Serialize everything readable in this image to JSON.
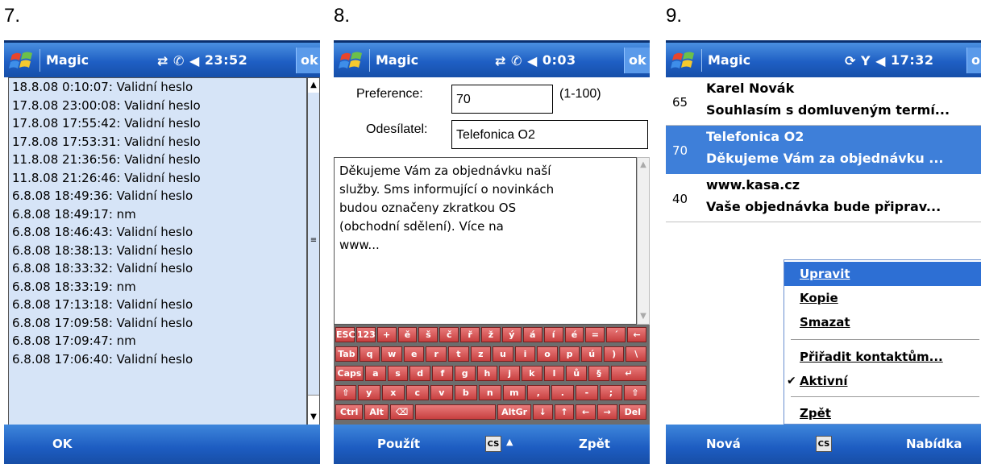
{
  "screens": [
    {
      "number": "7.",
      "title": "Magic",
      "clock": "23:52",
      "ok": "ok"
    },
    {
      "number": "8.",
      "title": "Magic",
      "clock": "0:03",
      "ok": "ok"
    },
    {
      "number": "9.",
      "title": "Magic",
      "clock": "17:32",
      "ok": "ok"
    }
  ],
  "screen7": {
    "log": [
      "18.8.08 0:10:07: Validní heslo",
      "17.8.08 23:00:08: Validní heslo",
      "17.8.08 17:55:42: Validní heslo",
      "17.8.08 17:53:31: Validní heslo",
      "11.8.08 21:36:56: Validní heslo",
      "11.8.08 21:26:46: Validní heslo",
      "6.8.08 18:49:36: Validní heslo",
      "6.8.08 18:49:17: nm",
      "6.8.08 18:46:43: Validní heslo",
      "6.8.08 18:38:13: Validní heslo",
      "6.8.08 18:33:32: Validní heslo",
      "6.8.08 18:33:19: nm",
      "6.8.08 17:13:18: Validní heslo",
      "6.8.08 17:09:58: Validní heslo",
      "6.8.08 17:09:47: nm",
      "6.8.08 17:06:40: Validní heslo"
    ],
    "softkey_left": "OK"
  },
  "screen8": {
    "preference_label": "Preference:",
    "preference_value": "70",
    "preference_range": "(1-100)",
    "sender_label": "Odesílatel:",
    "sender_value": "Telefonica O2",
    "message_lines": [
      "Děkujeme Vám za objednávku naší",
      "služby. Sms informující o novinkách",
      "budou označeny zkratkou OS",
      "(obchodní sdělení). Více na",
      "www..."
    ],
    "keyboard_rows": [
      [
        "ESC",
        "123",
        "+",
        "ě",
        "š",
        "č",
        "ř",
        "ž",
        "ý",
        "á",
        "í",
        "é",
        "=",
        "´",
        "←"
      ],
      [
        "Tab",
        "q",
        "w",
        "e",
        "r",
        "t",
        "z",
        "u",
        "i",
        "o",
        "p",
        "ú",
        ")",
        "\\"
      ],
      [
        "Caps",
        "a",
        "s",
        "d",
        "f",
        "g",
        "h",
        "j",
        "k",
        "l",
        "ů",
        "§",
        "↵"
      ],
      [
        "⇧",
        "y",
        "x",
        "c",
        "v",
        "b",
        "n",
        "m",
        ",",
        ".",
        "-",
        ";",
        "⇧"
      ],
      [
        "Ctrl",
        "Alt",
        "⌫",
        "",
        "AltGr",
        "↓",
        "↑",
        "←",
        "→",
        "Del"
      ]
    ],
    "softkey_left": "Použít",
    "input_mode": "CS",
    "softkey_right": "Zpět"
  },
  "screen9": {
    "items": [
      {
        "pref": "65",
        "sender": "Karel Novák",
        "text": "Souhlasím s domluveným termí..."
      },
      {
        "pref": "70",
        "sender": "Telefonica O2",
        "text": "Děkujeme Vám za objednávku ..."
      },
      {
        "pref": "40",
        "sender": "www.kasa.cz",
        "text": "Vaše objednávka bude připrav..."
      }
    ],
    "menu": {
      "edit": "Upravit",
      "copy": "Kopie",
      "delete": "Smazat",
      "assign": "Přiřadit kontaktům...",
      "active": "Aktivní",
      "back": "Zpět"
    },
    "softkey_left": "Nová",
    "input_mode": "CS",
    "softkey_right": "Nabídka"
  },
  "colors": {
    "titlebar": "#1f5fc4",
    "selection": "#3e7fd9",
    "log_background": "#d6e4f7",
    "keyboard_key": "#c84040"
  }
}
